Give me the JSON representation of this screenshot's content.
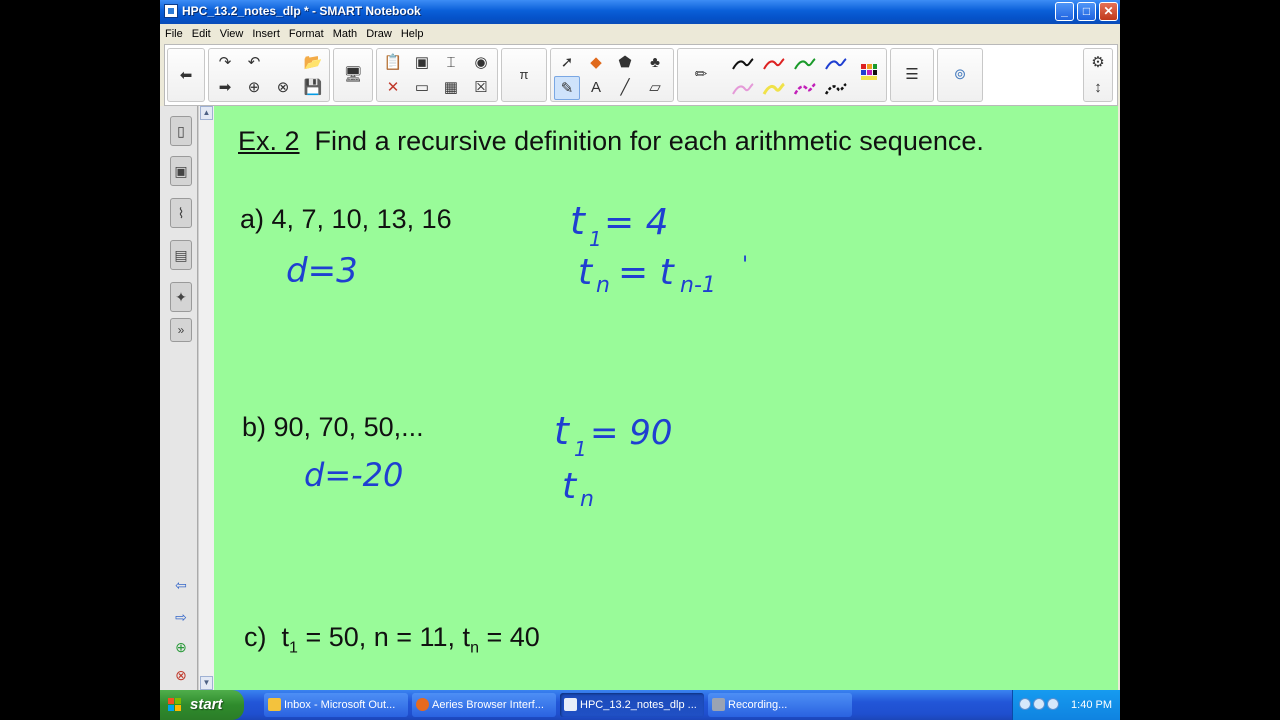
{
  "window": {
    "title": "HPC_13.2_notes_dlp * - SMART Notebook"
  },
  "menu": [
    "File",
    "Edit",
    "View",
    "Insert",
    "Format",
    "Math",
    "Draw",
    "Help"
  ],
  "content": {
    "heading_prefix": "Ex. 2",
    "heading_text": "Find a recursive definition for each arithmetic sequence.",
    "problems": {
      "a": "a)  4, 7, 10, 13, 16",
      "b": "b)  90, 70, 50,...",
      "c_label": "c)",
      "c_t": "t",
      "c_sub1": "1",
      "c_mid": " = 50,  n = 11, t",
      "c_subn": "n",
      "c_end": " = 40"
    },
    "handwriting": {
      "a_d": "d=3",
      "a_t1": "t",
      "a_t1_sub": "1",
      "a_t1_val": "= 4",
      "a_tn": "t",
      "a_tn_sub": "n",
      "a_tn_eq": "= t",
      "a_tn_rhs_sub": "n-1",
      "a_tn_tail": "'",
      "b_d": "d=-20",
      "b_t1": "t",
      "b_t1_sub": "1",
      "b_t1_val": "= 90",
      "b_tn": "t",
      "b_tn_sub": "n"
    },
    "ink_color": "#1f3fd1",
    "background_color": "#99fb99"
  },
  "taskbar": {
    "start_label": "start",
    "tasks": [
      {
        "label": "Inbox - Microsoft Out...",
        "icon": "outlook-icon"
      },
      {
        "label": "Aeries Browser Interf...",
        "icon": "firefox-icon"
      },
      {
        "label": "HPC_13.2_notes_dlp ...",
        "icon": "smart-notebook-icon"
      },
      {
        "label": "Recording...",
        "icon": "recorder-icon"
      }
    ],
    "clock": "1:40 PM"
  }
}
